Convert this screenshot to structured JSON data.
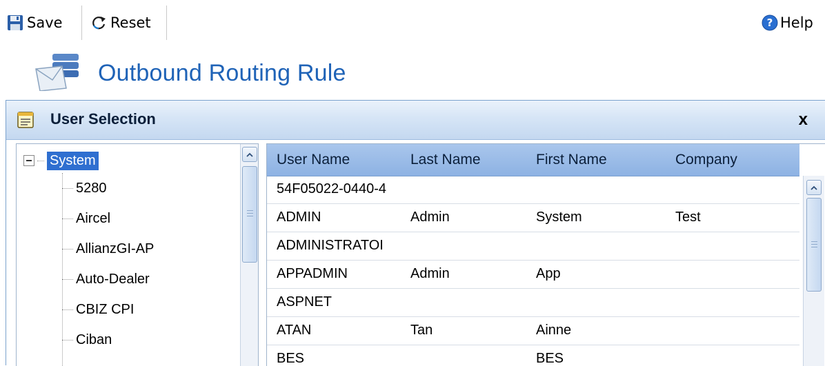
{
  "toolbar": {
    "save_label": "Save",
    "reset_label": "Reset",
    "help_label": "Help",
    "icons": {
      "save": "floppy-disk-icon",
      "reset": "refresh-icon",
      "help": "question-circle-icon"
    }
  },
  "page": {
    "title": "Outbound Routing Rule",
    "title_icon": "mail-server-icon",
    "title_color": "#1f63b7"
  },
  "dialog": {
    "title": "User Selection",
    "close_label": "x",
    "title_icon": "window-form-icon"
  },
  "tree": {
    "root": "System",
    "children": [
      "5280",
      "Aircel",
      "AllianzGI-AP",
      "Auto-Dealer",
      "CBIZ CPI",
      "Ciban"
    ]
  },
  "grid": {
    "columns": [
      "User Name",
      "Last Name",
      "First Name",
      "Company"
    ],
    "rows": [
      [
        "54F05022-0440-4",
        "",
        "",
        ""
      ],
      [
        "ADMIN",
        "Admin",
        "System",
        "Test"
      ],
      [
        "ADMINISTRATOI",
        "",
        "",
        ""
      ],
      [
        "APPADMIN",
        "Admin",
        "App",
        ""
      ],
      [
        "ASPNET",
        "",
        "",
        ""
      ],
      [
        "ATAN",
        "Tan",
        "Ainne",
        ""
      ],
      [
        "BES",
        "",
        "BES",
        ""
      ]
    ]
  },
  "colors": {
    "accent": "#2f6fd0",
    "header_gradient_top": "#a9c6ec",
    "header_gradient_bottom": "#8db2e3"
  }
}
